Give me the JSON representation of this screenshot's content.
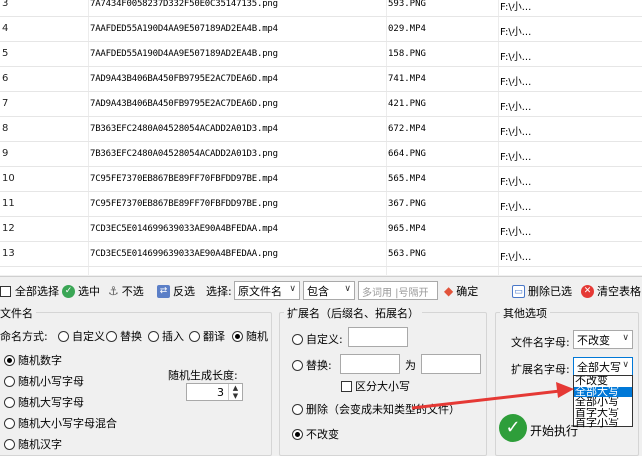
{
  "table": {
    "rows": [
      {
        "num": "3",
        "name": "7A7434F0058237D332F50E0C35147135.png",
        "newname": "593.PNG",
        "path": "F:\\小..."
      },
      {
        "num": "4",
        "name": "7AAFDED55A190D4AA9E507189AD2EA4B.mp4",
        "newname": "029.MP4",
        "path": "F:\\小..."
      },
      {
        "num": "5",
        "name": "7AAFDED55A190D4AA9E507189AD2EA4B.png",
        "newname": "158.PNG",
        "path": "F:\\小..."
      },
      {
        "num": "6",
        "name": "7AD9A43B406BA450FB9795E2AC7DEA6D.mp4",
        "newname": "741.MP4",
        "path": "F:\\小..."
      },
      {
        "num": "7",
        "name": "7AD9A43B406BA450FB9795E2AC7DEA6D.png",
        "newname": "421.PNG",
        "path": "F:\\小..."
      },
      {
        "num": "8",
        "name": "7B363EFC2480A04528054ACADD2A01D3.mp4",
        "newname": "672.MP4",
        "path": "F:\\小..."
      },
      {
        "num": "9",
        "name": "7B363EFC2480A04528054ACADD2A01D3.png",
        "newname": "664.PNG",
        "path": "F:\\小..."
      },
      {
        "num": "10",
        "name": "7C95FE7370EB867BE89FF70FBFDD97BE.mp4",
        "newname": "565.MP4",
        "path": "F:\\小..."
      },
      {
        "num": "11",
        "name": "7C95FE7370EB867BE89FF70FBFDD97BE.png",
        "newname": "367.PNG",
        "path": "F:\\小..."
      },
      {
        "num": "12",
        "name": "7CD3EC5E014699639033AE90A4BFEDAA.mp4",
        "newname": "965.MP4",
        "path": "F:\\小..."
      },
      {
        "num": "13",
        "name": "7CD3EC5E014699639033AE90A4BFEDAA.png",
        "newname": "563.PNG",
        "path": "F:\\小..."
      }
    ]
  },
  "toolbar": {
    "select_all": "全部选择",
    "select": "选中",
    "unselect": "不选",
    "invert": "反选",
    "choose_label": "选择:",
    "field_value": "原文件名",
    "match_value": "包含",
    "input_placeholder": "多词用 |号隔开",
    "confirm": "确定",
    "delete_selected": "删除已选",
    "clear_table": "清空表格"
  },
  "filename": {
    "title": "文件名",
    "method_label": "命名方式:",
    "opts": [
      "自定义",
      "替换",
      "插入",
      "翻译",
      "随机"
    ],
    "rand_opts": [
      "随机数字",
      "随机小写字母",
      "随机大写字母",
      "随机大小写字母混合",
      "随机汉字"
    ],
    "len_label": "随机生成长度:",
    "len_value": "3"
  },
  "ext": {
    "title": "扩展名（后缀名、拓展名）",
    "custom": "自定义:",
    "replace": "替换:",
    "to": "为",
    "case": "区分大小写",
    "delete": "删除（会变成未知类型的文件）",
    "keep": "不改变"
  },
  "other": {
    "title": "其他选项",
    "fn_case_label": "文件名字母:",
    "fn_case_value": "不改变",
    "ext_case_label": "扩展名字母:",
    "ext_case_value": "全部大写",
    "options": [
      "不改变",
      "全部大写",
      "全部小写",
      "首字大写",
      "首字小写"
    ],
    "start": "开始执行"
  },
  "colors": {
    "accent": "#0078d7",
    "arrow": "#e53935",
    "start": "#2e9e3a"
  }
}
